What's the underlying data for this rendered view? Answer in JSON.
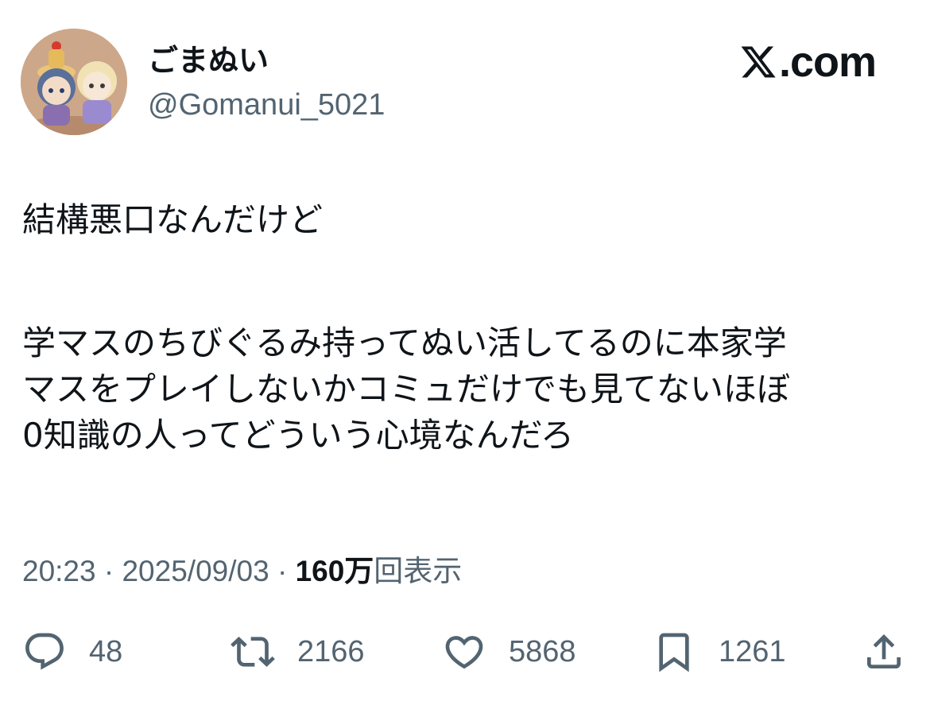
{
  "author": {
    "display_name": "ごまぬい",
    "handle": "@Gomanui_5021",
    "avatar_icon": "avatar-plush-dolls"
  },
  "brand": {
    "icon": "x-logo-icon",
    "text": ".com"
  },
  "tweet": {
    "paragraph_1": "結構悪口なんだけど",
    "paragraph_2_lines": [
      "学マスのちびぐるみ持ってぬい活してるのに本家学",
      "マスをプレイしないかコミュだけでも見てないほぼ",
      "0知識の人ってどういう心境なんだろ"
    ]
  },
  "meta": {
    "time": "20:23",
    "separator": " · ",
    "date": "2025/09/03",
    "views_count": "160万",
    "views_label": "回表示"
  },
  "actions": {
    "reply": {
      "icon": "reply-icon",
      "count": "48"
    },
    "repost": {
      "icon": "repost-icon",
      "count": "2166"
    },
    "like": {
      "icon": "heart-icon",
      "count": "5868"
    },
    "bookmark": {
      "icon": "bookmark-icon",
      "count": "1261"
    },
    "share": {
      "icon": "share-icon"
    }
  },
  "colors": {
    "text": "#0f1419",
    "secondary": "#536471",
    "background": "#ffffff"
  }
}
